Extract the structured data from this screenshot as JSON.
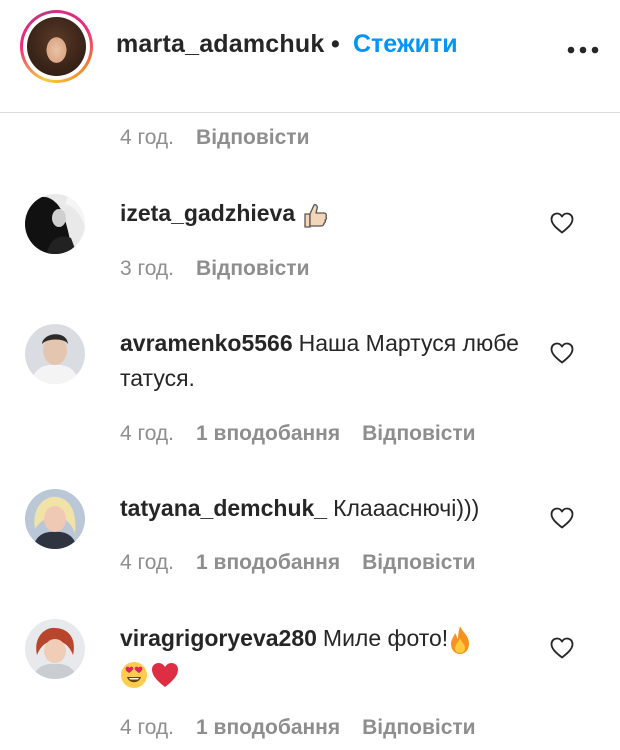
{
  "header": {
    "username": "marta_adamchuk",
    "separator": "•",
    "follow_label": "Стежити",
    "avatar_icon": "profile-photo",
    "more_icon": "more-horizontal-icon"
  },
  "top_meta": {
    "time": "4 год.",
    "reply_label": "Відповісти"
  },
  "comments": [
    {
      "username": "izeta_gadzhieva",
      "text": "",
      "emoji": [
        "thumbs-up"
      ],
      "time": "3 год.",
      "likes": "",
      "reply_label": "Відповісти"
    },
    {
      "username": "avramenko5566",
      "text": "Наша Мартуся любе татуся.",
      "emoji": [],
      "time": "4 год.",
      "likes": "1 вподобання",
      "reply_label": "Відповісти"
    },
    {
      "username": "tatyana_demchuk_",
      "text": "Клаааснючі)))",
      "emoji": [],
      "time": "4 год.",
      "likes": "1 вподобання",
      "reply_label": "Відповісти"
    },
    {
      "username": "viragrigoryeva280",
      "text": "Миле фото!",
      "emoji": [
        "fire",
        "heart-eyes",
        "red-heart"
      ],
      "time": "4 год.",
      "likes": "1 вподобання",
      "reply_label": "Відповісти"
    }
  ],
  "colors": {
    "link_blue": "#0095f6",
    "meta_gray": "#8e8e8e",
    "text": "#262626",
    "divider": "#dbdbdb"
  }
}
